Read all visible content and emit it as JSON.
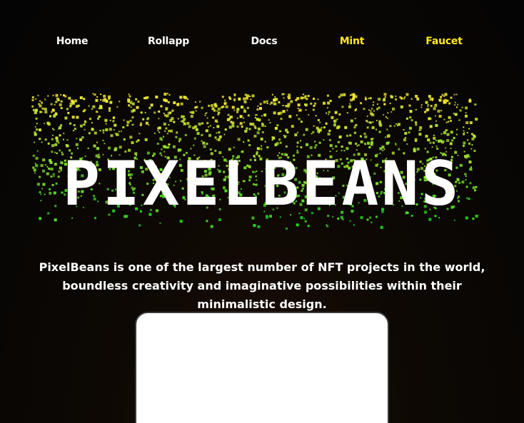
{
  "nav": {
    "items": [
      {
        "label": "Home"
      },
      {
        "label": "Rollapp"
      },
      {
        "label": "Docs"
      },
      {
        "label": "Mint"
      },
      {
        "label": "Faucet"
      }
    ]
  },
  "hero": {
    "title": "PIXELBEANS",
    "tagline": "PixelBeans is one of the largest number of NFT projects in the world, boundless creativity and imaginative possibilities within their minimalistic design."
  },
  "colors": {
    "accent": "#ffe81a",
    "particle_green": "#22dd22",
    "particle_yellow": "#ffee33",
    "text": "#ffffff"
  }
}
